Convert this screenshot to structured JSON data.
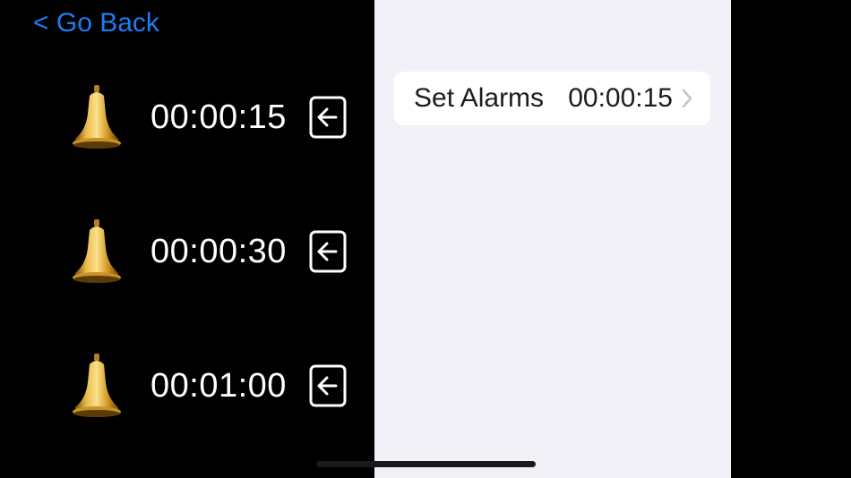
{
  "nav": {
    "back_label": "< Go Back"
  },
  "alarms": [
    {
      "time": "00:00:15",
      "icon": "bell-icon",
      "action_icon": "return-arrow-icon"
    },
    {
      "time": "00:00:30",
      "icon": "bell-icon",
      "action_icon": "return-arrow-icon"
    },
    {
      "time": "00:01:00",
      "icon": "bell-icon",
      "action_icon": "return-arrow-icon"
    }
  ],
  "settings": {
    "set_alarms_label": "Set Alarms",
    "set_alarms_value": "00:00:15",
    "chevron_icon": "chevron-right-icon"
  },
  "colors": {
    "accent": "#1e7cf2",
    "dark_background": "#000000",
    "light_background": "#f2f1f7",
    "cell_background": "#ffffff",
    "bell_gold": "#c8961e"
  }
}
